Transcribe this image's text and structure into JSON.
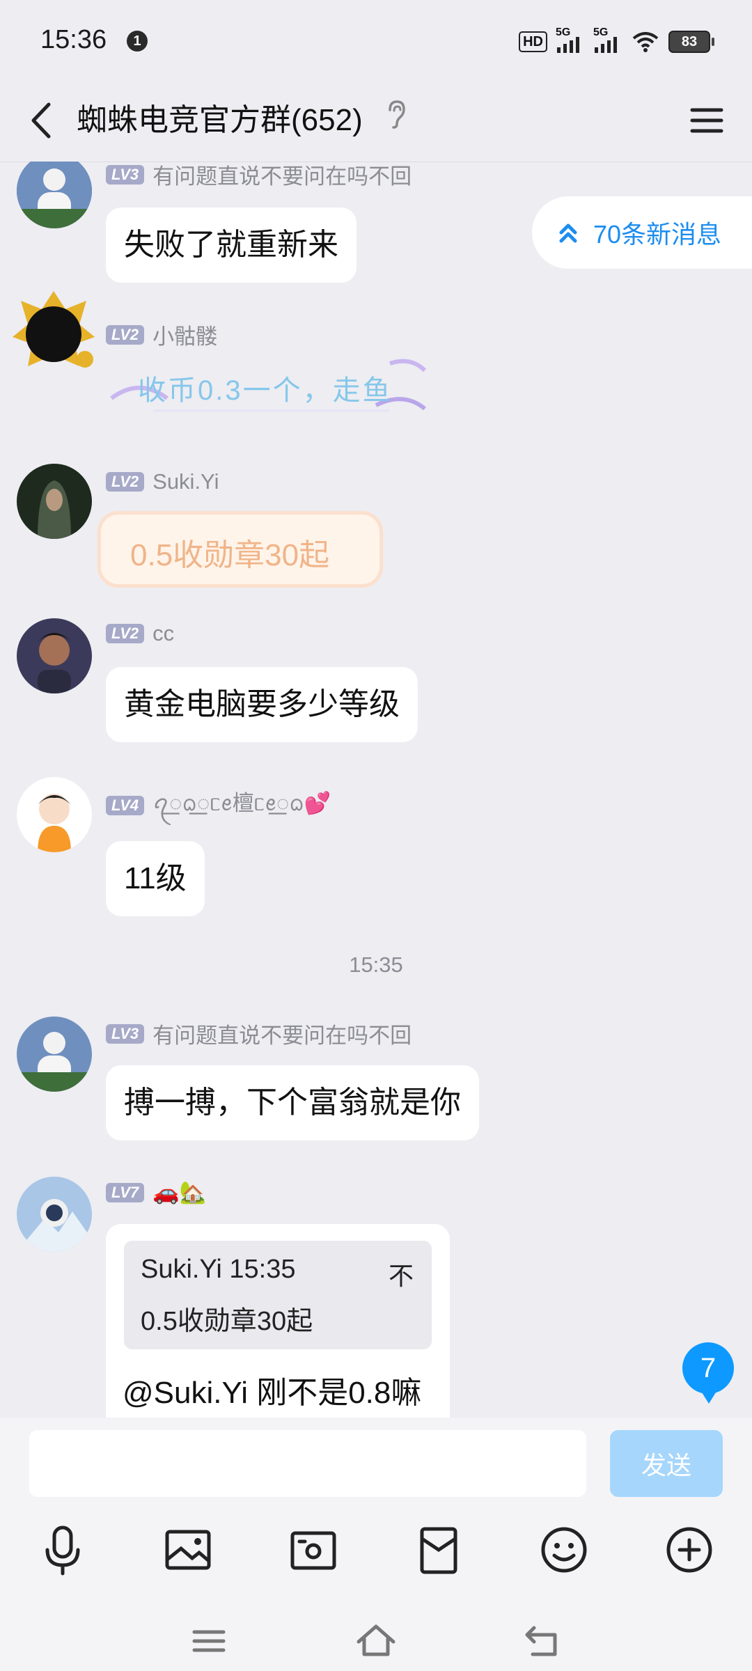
{
  "status_bar": {
    "time": "15:36",
    "notification_count": "1",
    "hd_label": "HD",
    "sim1_label": "5G",
    "sim2_label": "5G",
    "battery": "83"
  },
  "header": {
    "title": "蜘蛛电竞官方群(652)",
    "back_icon": "chevron-left-icon",
    "ear_icon": "ear-icon",
    "menu_icon": "hamburger-menu-icon"
  },
  "new_messages": {
    "label": "70条新消息",
    "icon": "double-chevron-up-icon"
  },
  "messages": [
    {
      "level": "LV3",
      "name": "有问题直说不要问在吗不回",
      "text": "失败了就重新来"
    },
    {
      "level": "LV2",
      "name": "小骷髅",
      "text": "收币0.3一个，走鱼"
    },
    {
      "level": "LV2",
      "name": "Suki.Yi",
      "text": "0.5收勋章30起"
    },
    {
      "level": "LV2",
      "name": "cc",
      "text": "黄金电脑要多少等级"
    },
    {
      "level": "LV4",
      "name": "ꪖ꯭ᨵ꯭ᥴꫀ檀ᥴꫀ꯭ᨵ💕",
      "text": "11级"
    },
    {
      "level": "LV3",
      "name": "有问题直说不要问在吗不回",
      "text": "搏一搏，下个富翁就是你"
    },
    {
      "level": "LV7",
      "name": "🚗🏡",
      "quote_head": "Suki.Yi 15:35",
      "quote_text": "0.5收勋章30起",
      "quote_pin": "不",
      "text": "@Suki.Yi 刚不是0.8嘛"
    }
  ],
  "time_separator": "15:35",
  "unread_badge": "7",
  "input": {
    "placeholder": "",
    "send_label": "发送"
  },
  "toolbar_icons": [
    "microphone-icon",
    "image-icon",
    "camera-icon",
    "red-packet-icon",
    "emoji-icon",
    "plus-icon"
  ],
  "nav_icons": [
    "recent-apps-icon",
    "home-icon",
    "back-icon"
  ],
  "colors": {
    "accent": "#1c8df0",
    "badge": "#0d99ff",
    "send_disabled": "#a6d6fb",
    "background": "#ededf2"
  }
}
